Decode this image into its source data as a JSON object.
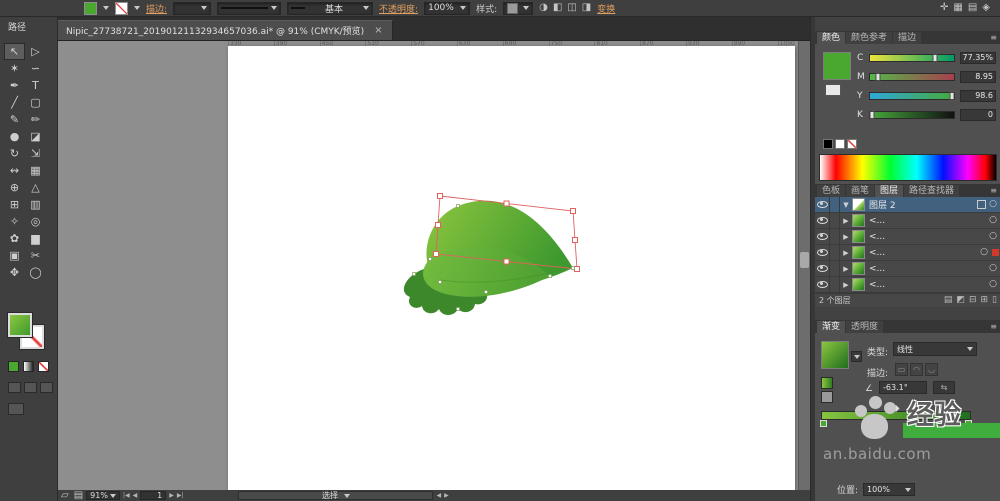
{
  "ui": {
    "panel_menu_glyph": "≡",
    "target_glyph": "○"
  },
  "colors": {
    "selection": "#e0625f",
    "accent_green": "#3fae3c",
    "layer_selected_bg": "#41617f",
    "swatch_green": "#4aa72f"
  },
  "control_bar": {
    "selection_type": "路径",
    "stroke_label": "描边:",
    "brush_value": "基本",
    "opacity_label": "不透明度:",
    "opacity_value": "100%",
    "style_label": "样式:",
    "transform_label": "变换",
    "icons": [
      {
        "id": "recolor-artwork-icon",
        "glyph": "◑"
      },
      {
        "id": "align-left-icon",
        "glyph": "◧"
      },
      {
        "id": "align-center-icon",
        "glyph": "◫"
      },
      {
        "id": "align-right-icon",
        "glyph": "◨"
      }
    ],
    "right_icons": [
      {
        "id": "shape-mode-icon",
        "glyph": "✛"
      },
      {
        "id": "arrange-documents-icon",
        "glyph": "▦"
      },
      {
        "id": "workspace-icon",
        "glyph": "▤"
      },
      {
        "id": "cs-live-icon",
        "glyph": "◈"
      }
    ]
  },
  "document_tab": {
    "title": "Nipic_27738721_20190121132934657036.ai* @ 91% (CMYK/预览)",
    "close_glyph": "×"
  },
  "tools": [
    {
      "id": "selection-tool",
      "glyph": "↖",
      "active": true
    },
    {
      "id": "direct-selection-tool",
      "glyph": "▷"
    },
    {
      "id": "magic-wand-tool",
      "glyph": "✶"
    },
    {
      "id": "lasso-tool",
      "glyph": "∽"
    },
    {
      "id": "pen-tool",
      "glyph": "✒"
    },
    {
      "id": "type-tool",
      "glyph": "T"
    },
    {
      "id": "line-segment-tool",
      "glyph": "╱"
    },
    {
      "id": "rectangle-tool",
      "glyph": "▢"
    },
    {
      "id": "paintbrush-tool",
      "glyph": "✎"
    },
    {
      "id": "pencil-tool",
      "glyph": "✏"
    },
    {
      "id": "blob-brush-tool",
      "glyph": "●"
    },
    {
      "id": "eraser-tool",
      "glyph": "◪"
    },
    {
      "id": "rotate-tool",
      "glyph": "↻"
    },
    {
      "id": "scale-tool",
      "glyph": "⇲"
    },
    {
      "id": "width-tool",
      "glyph": "↭"
    },
    {
      "id": "free-transform-tool",
      "glyph": "▦"
    },
    {
      "id": "shape-builder-tool",
      "glyph": "⊕"
    },
    {
      "id": "perspective-grid-tool",
      "glyph": "△"
    },
    {
      "id": "mesh-tool",
      "glyph": "⊞"
    },
    {
      "id": "gradient-tool",
      "glyph": "▥"
    },
    {
      "id": "eyedropper-tool",
      "glyph": "✧"
    },
    {
      "id": "blend-tool",
      "glyph": "◎"
    },
    {
      "id": "symbol-sprayer-tool",
      "glyph": "✿"
    },
    {
      "id": "column-graph-tool",
      "glyph": "▆"
    },
    {
      "id": "artboard-tool",
      "glyph": "▣"
    },
    {
      "id": "slice-tool",
      "glyph": "✂"
    },
    {
      "id": "hand-tool",
      "glyph": "✥"
    },
    {
      "id": "zoom-tool",
      "glyph": "◯"
    }
  ],
  "ruler": {
    "labels": [
      "330",
      "390",
      "450",
      "510",
      "570",
      "630",
      "690",
      "750",
      "810",
      "870",
      "930",
      "990",
      "1050"
    ]
  },
  "status_bar": {
    "zoom_value": "91%",
    "artboard_value": "1",
    "mode_value": "选择",
    "left_icons": [
      {
        "id": "artboard-nav-icon",
        "glyph": "▱"
      },
      {
        "id": "menu-grip-icon",
        "glyph": "▤"
      }
    ],
    "nav_icons": {
      "first": "|◀",
      "prev": "◀",
      "next": "▶",
      "last": "▶|"
    }
  },
  "color_panel": {
    "tabs": [
      {
        "id": "tab-color",
        "label": "颜色",
        "active": true
      },
      {
        "id": "tab-color-guide",
        "label": "颜色参考"
      },
      {
        "id": "tab-stroke-panel",
        "label": "描边"
      }
    ],
    "sliders": [
      {
        "label": "C",
        "value": "77.35%",
        "pos": 77,
        "from": "#efe43c",
        "to": "#009a68"
      },
      {
        "label": "M",
        "value": "8.95",
        "pos": 9,
        "from": "#52b948",
        "to": "#a63f4e"
      },
      {
        "label": "Y",
        "value": "98.6",
        "pos": 98,
        "from": "#2fa9d8",
        "to": "#46a93c"
      },
      {
        "label": "K",
        "value": "0",
        "pos": 2,
        "from": "#46a93c",
        "to": "#111111"
      }
    ]
  },
  "middle_tabs": [
    {
      "id": "tab-swatches",
      "label": "色板"
    },
    {
      "id": "tab-brushes",
      "label": "画笔"
    },
    {
      "id": "tab-layers",
      "label": "图层",
      "active": true
    },
    {
      "id": "tab-pathfinder",
      "label": "路径查找器"
    }
  ],
  "layers": {
    "rows": [
      {
        "name": "图层 2",
        "selected": true,
        "expander": "▼",
        "thumb": "light",
        "box": true
      },
      {
        "name": "<...",
        "expander": "▶",
        "thumb": "leaf"
      },
      {
        "name": "<...",
        "expander": "▶",
        "thumb": "leaf"
      },
      {
        "name": "<...",
        "expander": "▶",
        "thumb": "leaf",
        "red": true
      },
      {
        "name": "<...",
        "expander": "▶",
        "thumb": "leaf"
      },
      {
        "name": "<...",
        "expander": "▶",
        "thumb": "leaf"
      }
    ],
    "count_text": "2 个图层",
    "action_icons": [
      {
        "id": "collect-for-export-icon",
        "glyph": "▤"
      },
      {
        "id": "make-clipping-mask-icon",
        "glyph": "◩"
      },
      {
        "id": "new-sublayer-icon",
        "glyph": "⊟"
      },
      {
        "id": "new-layer-icon",
        "glyph": "⊞"
      },
      {
        "id": "delete-layer-icon",
        "glyph": "▯"
      }
    ]
  },
  "gradient_panel": {
    "tabs": [
      {
        "id": "tab-gradient",
        "label": "渐变",
        "active": true
      },
      {
        "id": "tab-transparency",
        "label": "透明度"
      }
    ],
    "type_label": "类型:",
    "type_value": "线性",
    "stroke_label": "描边:",
    "stroke_icons": [
      {
        "id": "stroke-within-icon",
        "glyph": "▭"
      },
      {
        "id": "stroke-along-icon",
        "glyph": "◠"
      },
      {
        "id": "stroke-across-icon",
        "glyph": "◡"
      }
    ],
    "angle_icon": "∠",
    "angle_value": "-63.1°",
    "reverse_icon": "⇆",
    "position_label": "位置:",
    "position_value": "100%"
  },
  "artwork": {
    "leaf_scallop": "#3c882b",
    "leaf_light": "#8dc63f",
    "leaf_dark_tip": "#3e992e",
    "leaf_front_light": "#76bd3f",
    "leaf_front_dark": "#4ea132"
  },
  "watermark": {
    "brand": "经验",
    "site_text": "an.baidu.com"
  }
}
